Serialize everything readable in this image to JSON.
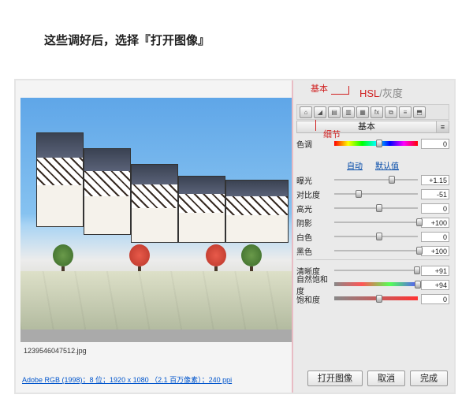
{
  "caption": "这些调好后，选择『打开图像』",
  "annotations": {
    "basic": "基本",
    "hsl": "HSL",
    "gray": "/灰度",
    "detail": "细节"
  },
  "preview": {
    "filename": "1239546047512.jpg",
    "info": "Adobe RGB (1998)；8 位；1920 x 1080 （2.1 百万像素）；240 ppi"
  },
  "panel": {
    "tab": "基本",
    "icons": [
      "⌂",
      "◢",
      "▤",
      "▥",
      "▦",
      "fx",
      "⧉",
      "≡",
      "⬒"
    ],
    "links": {
      "auto": "自动",
      "default": "默认值"
    },
    "sliders": [
      {
        "label": "色调",
        "value": "0",
        "pos": 50,
        "cls": "hue"
      },
      {
        "label": "曝光",
        "value": "+1.15",
        "pos": 65
      },
      {
        "label": "对比度",
        "value": "-51",
        "pos": 25
      },
      {
        "label": "高光",
        "value": "0",
        "pos": 50
      },
      {
        "label": "阴影",
        "value": "+100",
        "pos": 98
      },
      {
        "label": "白色",
        "value": "0",
        "pos": 50
      },
      {
        "label": "黑色",
        "value": "+100",
        "pos": 98
      },
      {
        "label": "清晰度",
        "value": "+91",
        "pos": 95
      },
      {
        "label": "自然饱和度",
        "value": "+94",
        "pos": 96,
        "cls": "vib"
      },
      {
        "label": "饱和度",
        "value": "0",
        "pos": 50,
        "cls": "sat"
      }
    ]
  },
  "buttons": {
    "open": "打开图像",
    "cancel": "取消",
    "done": "完成"
  }
}
